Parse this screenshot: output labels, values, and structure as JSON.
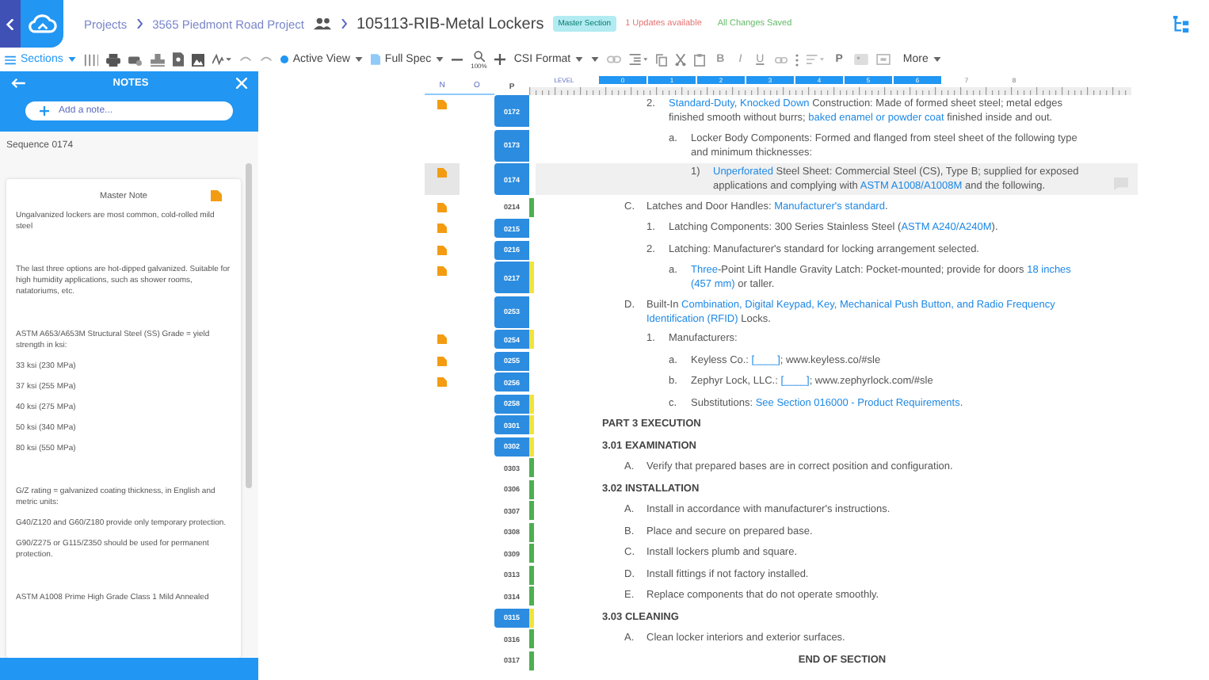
{
  "header": {
    "breadcrumbs": [
      "Projects",
      "3565 Piedmont Road Project"
    ],
    "title": "105113-RIB-Metal Lockers",
    "badge": "Master Section",
    "updates": "1 Updates available",
    "saved": "All Changes Saved"
  },
  "toolbar": {
    "sections": "Sections",
    "view": "Active View",
    "spec": "Full Spec",
    "zoom": "100%",
    "format": "CSI Format",
    "bold": "B",
    "italic": "I",
    "underline": "U",
    "paragraph": "P",
    "more": "More"
  },
  "notes_panel": {
    "title": "NOTES",
    "add_placeholder": "Add a note...",
    "sequence": "Sequence 0174",
    "note": {
      "title": "Master Note",
      "paragraph_groups": [
        [
          "Ungalvanized lockers are most common, cold-rolled mild steel"
        ],
        [
          "The last three options are hot-dipped galvanized. Suitable for high humidity applications, such as shower rooms, natatoriums, etc."
        ],
        [
          "ASTM A653/A653M Structural Steel (SS) Grade = yield strength in ksi:",
          "33 ksi (230 MPa)",
          "37 ksi (255 MPa)",
          "40 ksi (275 MPa)",
          "50 ksi (340 MPa)",
          "80 ksi (550 MPa)"
        ],
        [
          "G/Z rating = galvanized coating thickness, in English and metric units:",
          "G40/Z120 and G60/Z180 provide only temporary protection.",
          "G90/Z275 or G115/Z350 should be used for permanent protection."
        ],
        [
          "ASTM A1008 Prime High Grade Class 1 Mild Annealed"
        ]
      ]
    }
  },
  "document": {
    "columns": [
      "N",
      "O",
      "P"
    ],
    "level_label": "LEVEL",
    "levels": [
      {
        "label": "0",
        "selected": true
      },
      {
        "label": "1",
        "selected": true
      },
      {
        "label": "2",
        "selected": true
      },
      {
        "label": "3",
        "selected": true
      },
      {
        "label": "4",
        "selected": true
      },
      {
        "label": "5",
        "selected": true
      },
      {
        "label": "6",
        "selected": true
      },
      {
        "label": "7",
        "selected": false
      },
      {
        "label": "8",
        "selected": false
      }
    ],
    "rows": [
      {
        "children": [
          {
            "children": [
              {
                "seq": "0172",
                "selected": true,
                "note": true,
                "current": false,
                "kind": "item",
                "marker": "2.",
                "segments": [
                  {
                    "text": "Standard-Duty, Knocked Down",
                    "term": true
                  },
                  {
                    "text": " Construction:  Made of formed sheet steel; metal edges finished smooth without burrs; ",
                    "term": false
                  },
                  {
                    "text": "baked enamel or powder coat",
                    "term": true
                  },
                  {
                    "text": " finished inside and out.",
                    "term": false
                  }
                ],
                "children": [
                  {
                    "seq": "0173",
                    "selected": true,
                    "note": false,
                    "current": false,
                    "kind": "item",
                    "marker": "a.",
                    "segments": [
                      {
                        "text": "Locker Body Components:  Formed and flanged from steel sheet of the following type and minimum thicknesses:",
                        "term": false
                      }
                    ],
                    "children": [
                      {
                        "seq": "0174",
                        "selected": true,
                        "note": true,
                        "current": true,
                        "kind": "item",
                        "marker": "1)",
                        "segments": [
                          {
                            "text": "Unperforated",
                            "term": true
                          },
                          {
                            "text": " Steel Sheet:  Commercial Steel (CS), Type B; supplied for exposed applications and complying with ",
                            "term": false
                          },
                          {
                            "text": "ASTM A1008/A1008M",
                            "term": true
                          },
                          {
                            "text": " and the following.",
                            "term": false
                          }
                        ]
                      }
                    ]
                  }
                ]
              }
            ]
          },
          {
            "seq": "0214",
            "selected": false,
            "color": "#4caf50",
            "note": true,
            "current": false,
            "kind": "item",
            "marker": "C.",
            "segments": [
              {
                "text": "Latches and Door Handles:  ",
                "term": false
              },
              {
                "text": "Manufacturer's standard",
                "term": true
              },
              {
                "text": ".",
                "term": false
              }
            ],
            "children": [
              {
                "seq": "0215",
                "selected": true,
                "note": true,
                "current": false,
                "kind": "item",
                "marker": "1.",
                "segments": [
                  {
                    "text": "Latching Components: 300 Series Stainless Steel (",
                    "term": false
                  },
                  {
                    "text": "ASTM A240/A240M",
                    "term": true
                  },
                  {
                    "text": ").",
                    "term": false
                  }
                ]
              },
              {
                "seq": "0216",
                "selected": true,
                "note": true,
                "current": false,
                "kind": "item",
                "marker": "2.",
                "segments": [
                  {
                    "text": "Latching:  Manufacturer's standard for locking arrangement selected.",
                    "term": false
                  }
                ],
                "children": [
                  {
                    "seq": "0217",
                    "selected": true,
                    "color": "#f2e33c",
                    "note": true,
                    "current": false,
                    "kind": "item",
                    "marker": "a.",
                    "segments": [
                      {
                        "text": "Three",
                        "term": true
                      },
                      {
                        "text": "-Point Lift Handle Gravity Latch:  Pocket-mounted; provide for doors ",
                        "term": false
                      },
                      {
                        "text": "18 inches (457 mm)",
                        "term": true
                      },
                      {
                        "text": " or taller.",
                        "term": false
                      }
                    ]
                  }
                ]
              }
            ]
          },
          {
            "seq": "0253",
            "selected": true,
            "note": false,
            "current": false,
            "kind": "item",
            "marker": "D.",
            "segments": [
              {
                "text": "Built-In ",
                "term": false
              },
              {
                "text": "Combination, Digital Keypad, Key, Mechanical Push Button, and Radio Frequency Identification (RFID)",
                "term": true
              },
              {
                "text": " Locks.",
                "term": false
              }
            ],
            "children": [
              {
                "seq": "0254",
                "selected": true,
                "color": "#f2e33c",
                "note": true,
                "current": false,
                "kind": "item",
                "marker": "1.",
                "segments": [
                  {
                    "text": "Manufacturers:",
                    "term": false
                  }
                ],
                "children": [
                  {
                    "seq": "0255",
                    "selected": true,
                    "note": true,
                    "current": false,
                    "kind": "item",
                    "marker": "a.",
                    "segments": [
                      {
                        "text": "Keyless Co.: ",
                        "term": false
                      },
                      {
                        "text": "[____]",
                        "term": true
                      },
                      {
                        "text": ";  www.keyless.co/#sle",
                        "term": false
                      }
                    ]
                  },
                  {
                    "seq": "0256",
                    "selected": true,
                    "note": true,
                    "current": false,
                    "kind": "item",
                    "marker": "b.",
                    "segments": [
                      {
                        "text": "Zephyr Lock, LLC.: ",
                        "term": false
                      },
                      {
                        "text": "[____]",
                        "term": true
                      },
                      {
                        "text": ";  www.zephyrlock.com/#sle",
                        "term": false
                      }
                    ]
                  },
                  {
                    "seq": "0258",
                    "selected": true,
                    "color": "#f2e33c",
                    "note": false,
                    "current": false,
                    "kind": "item",
                    "marker": "c.",
                    "segments": [
                      {
                        "text": "Substitutions:  ",
                        "term": false
                      },
                      {
                        "text": "See Section 016000 - Product Requirements",
                        "term": true
                      },
                      {
                        "text": ".",
                        "term": false
                      }
                    ]
                  }
                ]
              }
            ]
          }
        ]
      },
      {
        "seq": "0301",
        "selected": true,
        "color": "#f2e33c",
        "note": false,
        "current": false,
        "kind": "heading",
        "segments": [
          {
            "text": "PART 3  EXECUTION",
            "term": false
          }
        ]
      },
      {
        "seq": "0302",
        "selected": true,
        "color": "#f2e33c",
        "note": false,
        "current": false,
        "kind": "heading",
        "segments": [
          {
            "text": "3.01  EXAMINATION",
            "term": false
          }
        ],
        "children": [
          {
            "seq": "0303",
            "selected": false,
            "color": "#4caf50",
            "note": false,
            "current": false,
            "kind": "item",
            "marker": "A.",
            "segments": [
              {
                "text": "Verify that prepared bases are in correct position and configuration.",
                "term": false
              }
            ]
          }
        ]
      },
      {
        "seq": "0306",
        "selected": false,
        "color": "#4caf50",
        "note": false,
        "current": false,
        "kind": "heading",
        "segments": [
          {
            "text": "3.02  INSTALLATION",
            "term": false
          }
        ],
        "children": [
          {
            "seq": "0307",
            "selected": false,
            "color": "#4caf50",
            "note": false,
            "current": false,
            "kind": "item",
            "marker": "A.",
            "segments": [
              {
                "text": "Install in accordance with manufacturer's instructions.",
                "term": false
              }
            ]
          },
          {
            "seq": "0308",
            "selected": false,
            "color": "#4caf50",
            "note": false,
            "current": false,
            "kind": "item",
            "marker": "B.",
            "segments": [
              {
                "text": "Place and secure on prepared base.",
                "term": false
              }
            ]
          },
          {
            "seq": "0309",
            "selected": false,
            "color": "#4caf50",
            "note": false,
            "current": false,
            "kind": "item",
            "marker": "C.",
            "segments": [
              {
                "text": "Install lockers plumb and square.",
                "term": false
              }
            ]
          },
          {
            "seq": "0313",
            "selected": false,
            "color": "#4caf50",
            "note": false,
            "current": false,
            "kind": "item",
            "marker": "D.",
            "segments": [
              {
                "text": "Install fittings if not factory installed.",
                "term": false
              }
            ]
          },
          {
            "seq": "0314",
            "selected": false,
            "color": "#4caf50",
            "note": false,
            "current": false,
            "kind": "item",
            "marker": "E.",
            "segments": [
              {
                "text": "Replace components that do not operate smoothly.",
                "term": false
              }
            ]
          }
        ]
      },
      {
        "seq": "0315",
        "selected": true,
        "color": "#f2e33c",
        "note": false,
        "current": false,
        "kind": "heading",
        "segments": [
          {
            "text": "3.03  CLEANING",
            "term": false
          }
        ],
        "children": [
          {
            "seq": "0316",
            "selected": false,
            "color": "#4caf50",
            "note": false,
            "current": false,
            "kind": "item",
            "marker": "A.",
            "segments": [
              {
                "text": "Clean locker interiors and exterior surfaces.",
                "term": false
              }
            ]
          }
        ]
      },
      {
        "seq": "0317",
        "selected": false,
        "color": "#4caf50",
        "note": false,
        "current": false,
        "kind": "end",
        "text": "END OF SECTION"
      }
    ]
  }
}
